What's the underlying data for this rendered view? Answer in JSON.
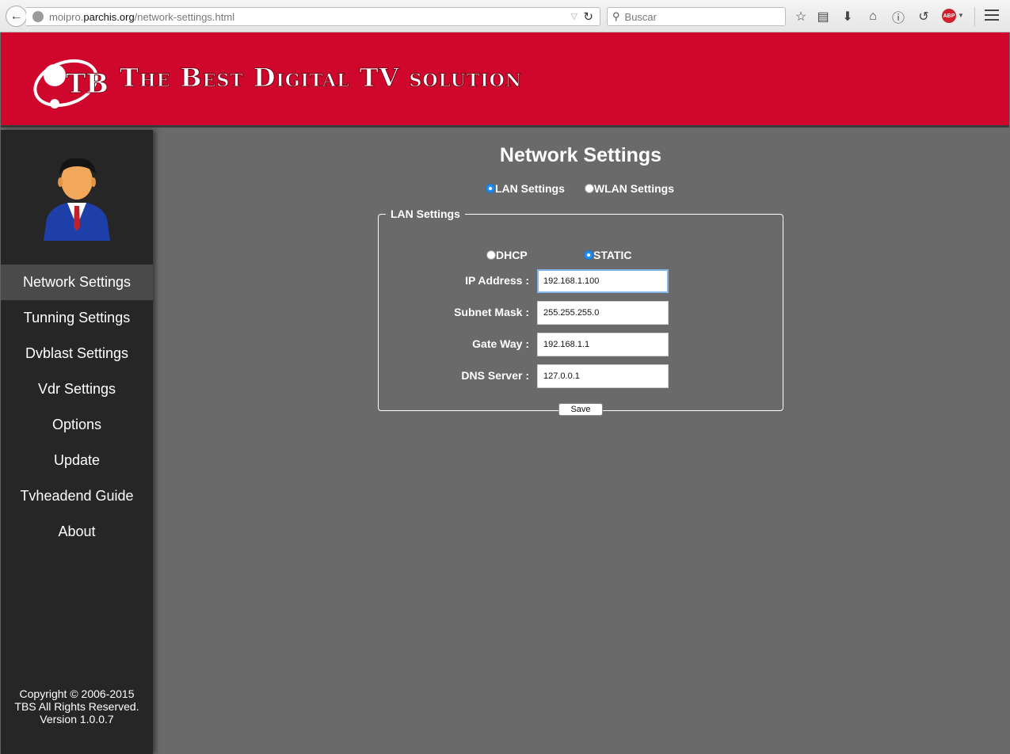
{
  "browser": {
    "url_prefix": "moipro.",
    "url_domain": "parchis.org",
    "url_path": "/network-settings.html",
    "search_placeholder": "Buscar",
    "adblock_label": "ABP"
  },
  "banner": {
    "slogan": "The Best Digital TV solution",
    "logo_text": "TBS",
    "color": "#d0072c"
  },
  "sidebar": {
    "items": [
      {
        "label": "Network Settings",
        "active": true
      },
      {
        "label": "Tunning Settings"
      },
      {
        "label": "Dvblast Settings"
      },
      {
        "label": "Vdr Settings"
      },
      {
        "label": "Options"
      },
      {
        "label": "Update"
      },
      {
        "label": "Tvheadend Guide"
      },
      {
        "label": "About"
      }
    ],
    "copyright": "Copyright © 2006-2015",
    "rights": "TBS All Rights Reserved.",
    "version": "Version 1.0.0.7"
  },
  "main": {
    "title": "Network Settings",
    "mode_lan": "LAN Settings",
    "mode_wlan": "WLAN Settings",
    "selected_mode": "LAN Settings",
    "panel_legend": "LAN Settings",
    "ip_dhcp": "DHCP",
    "ip_static": "STATIC",
    "selected_ip_mode": "STATIC",
    "fields": {
      "ip_label": "IP Address :",
      "ip_value": "192.168.1.100",
      "subnet_label": "Subnet Mask :",
      "subnet_value": "255.255.255.0",
      "gateway_label": "Gate Way :",
      "gateway_value": "192.168.1.1",
      "dns_label": "DNS Server :",
      "dns_value": "127.0.0.1"
    },
    "save_label": "Save"
  },
  "colors": {
    "accent": "#1f8ef7",
    "sidebar_bg": "#262626",
    "content_bg": "#6a6a6a"
  }
}
